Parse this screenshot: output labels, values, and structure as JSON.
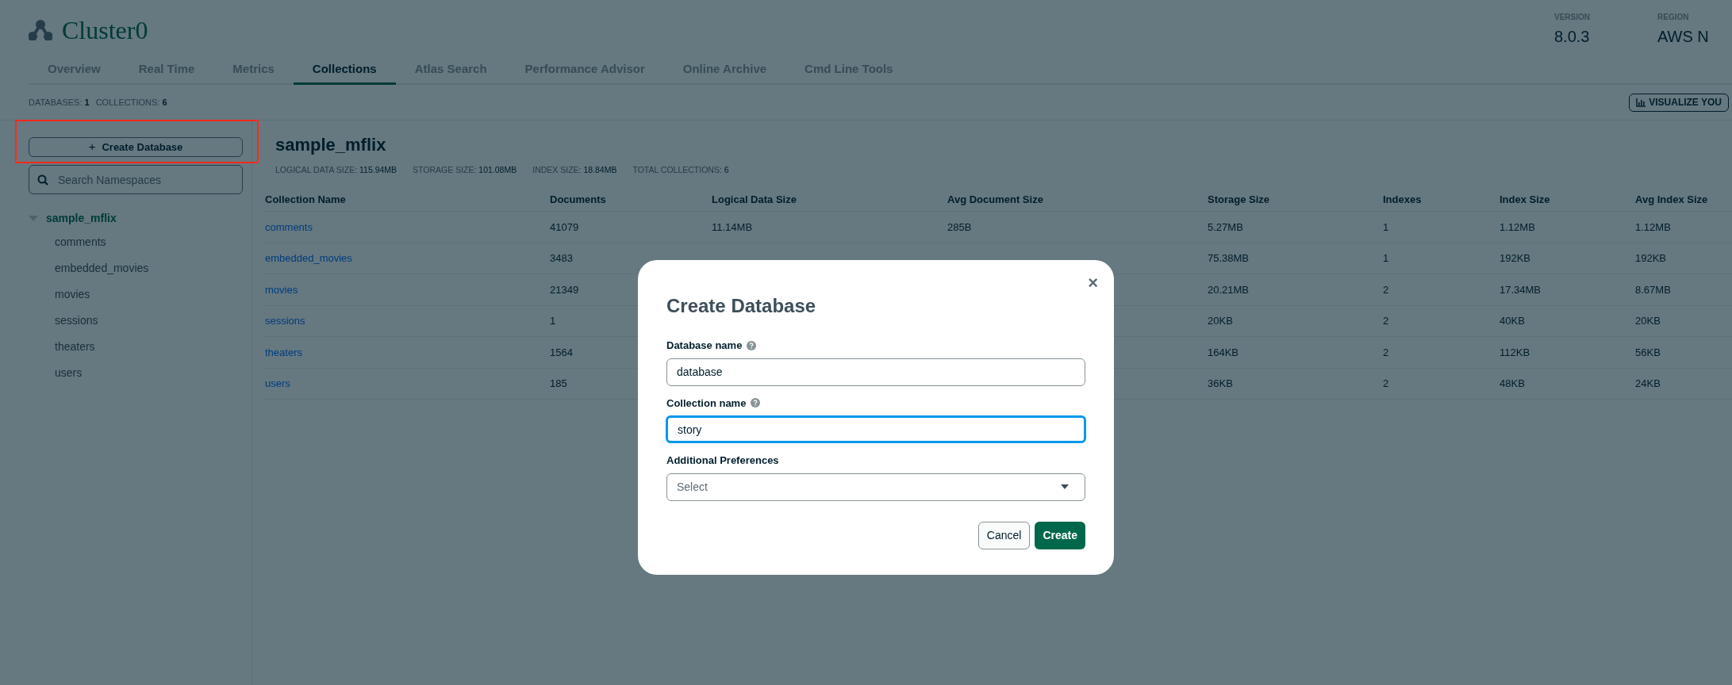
{
  "header": {
    "title": "Cluster0",
    "meta": [
      {
        "label": "VERSION",
        "value": "8.0.3"
      },
      {
        "label": "REGION",
        "value": "AWS N"
      }
    ]
  },
  "tabs": [
    {
      "label": "Overview",
      "selected": false
    },
    {
      "label": "Real Time",
      "selected": false
    },
    {
      "label": "Metrics",
      "selected": false
    },
    {
      "label": "Collections",
      "selected": true
    },
    {
      "label": "Atlas Search",
      "selected": false
    },
    {
      "label": "Performance Advisor",
      "selected": false
    },
    {
      "label": "Online Archive",
      "selected": false
    },
    {
      "label": "Cmd Line Tools",
      "selected": false
    }
  ],
  "summary": [
    {
      "label": "DATABASES:",
      "value": "1"
    },
    {
      "label": "COLLECTIONS:",
      "value": "6"
    }
  ],
  "visualize_button": "VISUALIZE YOU",
  "sidebar": {
    "create_button": {
      "icon": "+",
      "label": "Create Database",
      "highlighted": true
    },
    "search": {
      "placeholder": "Search Namespaces"
    },
    "tree": [
      {
        "label": "sample_mflix",
        "expanded": true,
        "children": [
          {
            "label": "comments"
          },
          {
            "label": "embedded_movies"
          },
          {
            "label": "movies"
          },
          {
            "label": "sessions"
          },
          {
            "label": "theaters"
          },
          {
            "label": "users"
          }
        ]
      }
    ]
  },
  "database": {
    "title": "sample_mflix",
    "stats": [
      {
        "label": "LOGICAL DATA SIZE:",
        "value": "115.94MB"
      },
      {
        "label": "STORAGE SIZE:",
        "value": "101.08MB"
      },
      {
        "label": "INDEX SIZE:",
        "value": "18.84MB"
      },
      {
        "label": "TOTAL COLLECTIONS:",
        "value": "6"
      }
    ]
  },
  "table": {
    "columns": [
      "Collection Name",
      "Documents",
      "Logical Data Size",
      "Avg Document Size",
      "Storage Size",
      "Indexes",
      "Index Size",
      "Avg Index Size"
    ],
    "rows": [
      [
        "comments",
        "41079",
        "11.14MB",
        "285B",
        "5.27MB",
        "1",
        "1.12MB",
        "1.12MB"
      ],
      [
        "embedded_movies",
        "3483",
        null,
        null,
        "75.38MB",
        "1",
        "192KB",
        "192KB"
      ],
      [
        "movies",
        "21349",
        null,
        null,
        "20.21MB",
        "2",
        "17.34MB",
        "8.67MB"
      ],
      [
        "sessions",
        "1",
        null,
        null,
        "20KB",
        "2",
        "40KB",
        "20KB"
      ],
      [
        "theaters",
        "1564",
        null,
        null,
        "164KB",
        "2",
        "112KB",
        "56KB"
      ],
      [
        "users",
        "185",
        null,
        null,
        "36KB",
        "2",
        "48KB",
        "24KB"
      ]
    ]
  },
  "modal": {
    "title": "Create Database",
    "close": "×",
    "fields": [
      {
        "kind": "text",
        "label": "Database name",
        "value": "database",
        "focused": false
      },
      {
        "kind": "text",
        "label": "Collection name",
        "value": "story",
        "focused": true
      },
      {
        "kind": "select",
        "label": "Additional Preferences",
        "placeholder": "Select"
      }
    ],
    "buttons": [
      {
        "label": "Cancel",
        "primary": false
      },
      {
        "label": "Create",
        "primary": true
      }
    ]
  }
}
